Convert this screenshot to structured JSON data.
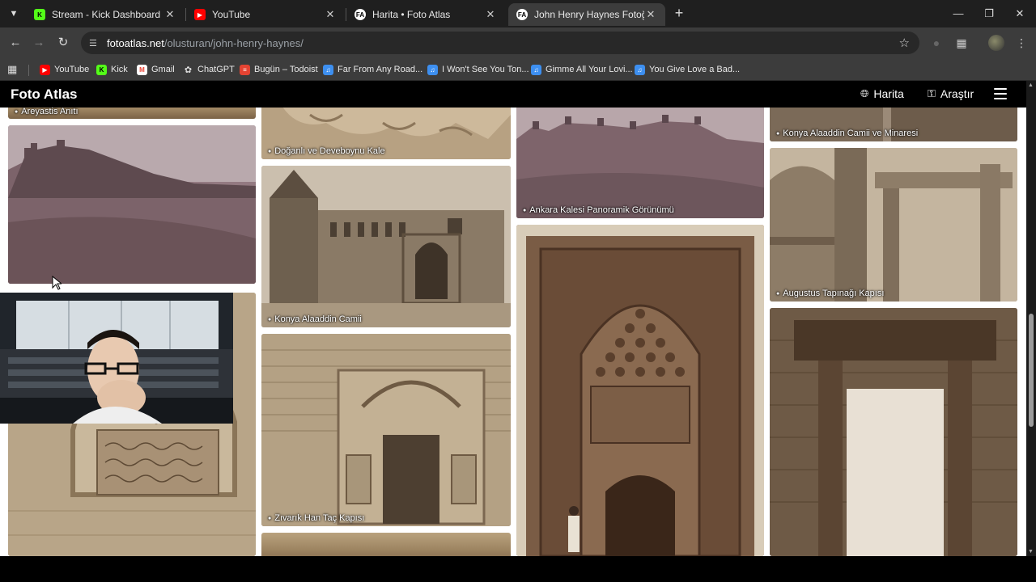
{
  "browser": {
    "tabs": [
      {
        "title": "Stream - Kick Dashboard",
        "favicon": "kick-icon",
        "active": false
      },
      {
        "title": "YouTube",
        "favicon": "youtube-icon",
        "active": false
      },
      {
        "title": "Harita • Foto Atlas",
        "favicon": "fotoatlas-icon",
        "active": false
      },
      {
        "title": "John Henry Haynes Fotoğrafları",
        "favicon": "fotoatlas-icon",
        "active": true
      }
    ],
    "url_host": "fotoatlas.net",
    "url_path": "/olusturan/john-henry-haynes/",
    "bookmarks": [
      {
        "label": "YouTube",
        "icon": "youtube-icon",
        "color": "#ff0000"
      },
      {
        "label": "Kick",
        "icon": "kick-icon",
        "color": "#53fc18"
      },
      {
        "label": "Gmail",
        "icon": "gmail-icon",
        "color": "#ea4335"
      },
      {
        "label": "ChatGPT",
        "icon": "chatgpt-icon",
        "color": "#ffffff"
      },
      {
        "label": "Bugün – Todoist",
        "icon": "todoist-icon",
        "color": "#e44332"
      },
      {
        "label": "Far From Any Road...",
        "icon": "bookmark-icon",
        "color": "#3d8ff0"
      },
      {
        "label": "I Won't See You Ton...",
        "icon": "bookmark-icon",
        "color": "#3d8ff0"
      },
      {
        "label": "Gimme All Your Lovi...",
        "icon": "bookmark-icon",
        "color": "#3d8ff0"
      },
      {
        "label": "You Give Love a Bad...",
        "icon": "bookmark-icon",
        "color": "#3d8ff0"
      }
    ]
  },
  "site": {
    "logo": "Foto Atlas",
    "nav": [
      {
        "label": "Harita",
        "icon": "globe-icon"
      },
      {
        "label": "Araştır",
        "icon": "search-person-icon"
      }
    ],
    "menu_icon": "hamburger-icon"
  },
  "gallery": {
    "captions": {
      "c1_top": "Areyastis Anıtı",
      "c2_top": "Doğanlı ve Deveboynu Kale",
      "c2_mid": "Konya Alaaddin Camii",
      "c2_bot": "Zıvarık Han Taç Kapısı",
      "c3_top": "Ankara Kalesi Panoramik Görünümü",
      "c4_top": "Konya Alaaddin Camii ve Minaresi",
      "c4_mid": "Augustus Tapınağı Kapısı"
    }
  },
  "colors": {
    "site_header_bg": "#000000",
    "page_bg": "#ffffff",
    "chrome_bg": "#3c3c3c",
    "tabbar_bg": "#1f1f1f"
  }
}
